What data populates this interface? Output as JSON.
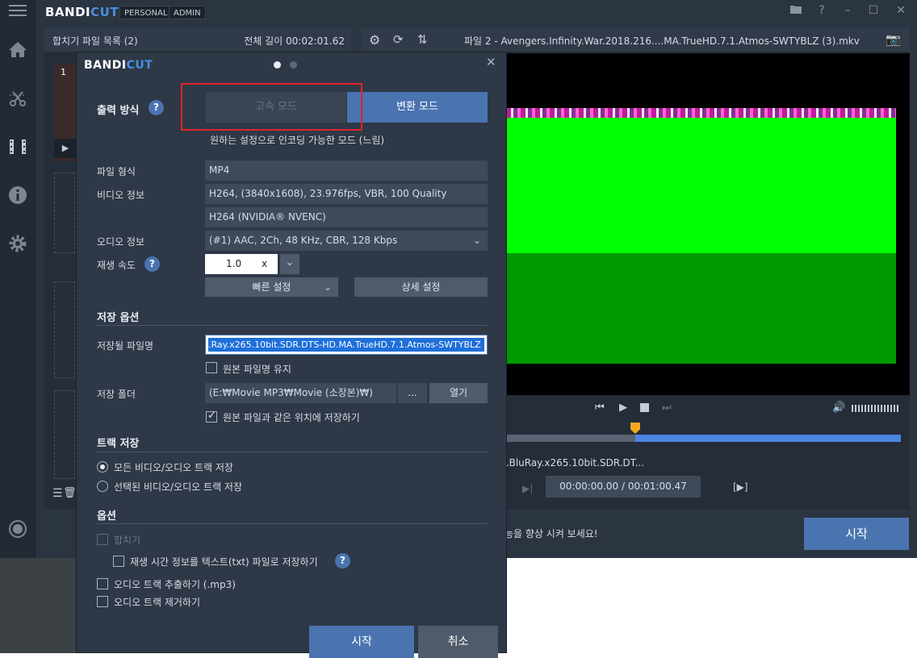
{
  "app": {
    "logo_main": "BANDI",
    "logo_cut": "CUT",
    "tag_personal": "PERSONAL",
    "tag_admin": "ADMIN"
  },
  "sidebar": {
    "icons": [
      "menu-icon",
      "home-icon",
      "cut-icon",
      "film-icon",
      "info-icon",
      "gear-icon",
      "record-icon"
    ]
  },
  "list_panel": {
    "title": "합치기 파일 목록 (2)",
    "total_length_label": "전체 길이 00:02:01.62",
    "first_item_number": "1"
  },
  "preview": {
    "file_title": "파일 2 - Avengers.Infinity.War.2018.216....MA.TrueHD.7.1.Atmos-SWTYBLZ (3).mkv",
    "filename_line": "ngers.Infinity.War.2018.2160p.BluRay.x265.10bit.SDR.DT...",
    "time_display": "00:00:00.00 / 00:01:00.47",
    "footer_tip": "능을 향상 시켜 보세요!",
    "start_label": "시작"
  },
  "dialog": {
    "logo_main": "BANDI",
    "logo_cut": "CUT",
    "output_mode_label": "출력 방식",
    "mode_fast": "고속 모드",
    "mode_convert": "변환 모드",
    "mode_desc": "원하는 설정으로 인코딩 가능한 모드 (느림)",
    "file_format_label": "파일 형식",
    "file_format_value": "MP4",
    "video_info_label": "비디오 정보",
    "video_info_value": "H264, (3840x1608), 23.976fps, VBR, 100 Quality",
    "video_encoder_value": "H264 (NVIDIA® NVENC)",
    "audio_info_label": "오디오 정보",
    "audio_info_value": "(#1) AAC, 2Ch, 48 KHz, CBR, 128 Kbps",
    "speed_label": "재생 속도",
    "speed_value": "1.0",
    "speed_unit": "x",
    "quick_settings": "빠른 설정",
    "detail_settings": "상세 설정",
    "save_options_title": "저장 옵션",
    "save_filename_label": "저장될 파일명",
    "save_filename_value": ".Ray.x265.10bit.SDR.DTS-HD.MA.TrueHD.7.1.Atmos-SWTYBLZ",
    "keep_original_name": "원본 파일명 유지",
    "save_folder_label": "저장 폴더",
    "save_folder_value": "(E:₩Movie MP3₩Movie (소장본)₩)",
    "browse_label": "...",
    "open_label": "열기",
    "save_same_location": "원본 파일과 같은 위치에 저장하기",
    "track_save_title": "트랙 저장",
    "all_tracks": "모든 비디오/오디오 트랙 저장",
    "selected_tracks": "선택된 비디오/오디오 트랙 저장",
    "options_title": "옵션",
    "merge_label": "합치기",
    "save_time_info": "재생 시간 정보를 텍스트(txt) 파일로 저장하기",
    "extract_audio": "오디오 트랙 추출하기 (.mp3)",
    "remove_audio": "오디오 트랙 제거하기",
    "start_label": "시작",
    "cancel_label": "취소"
  },
  "colors": {
    "accent": "#4a74b0",
    "highlight_border": "#e0242b",
    "video_green": "#00ff00",
    "video_dark_green": "#009900"
  }
}
